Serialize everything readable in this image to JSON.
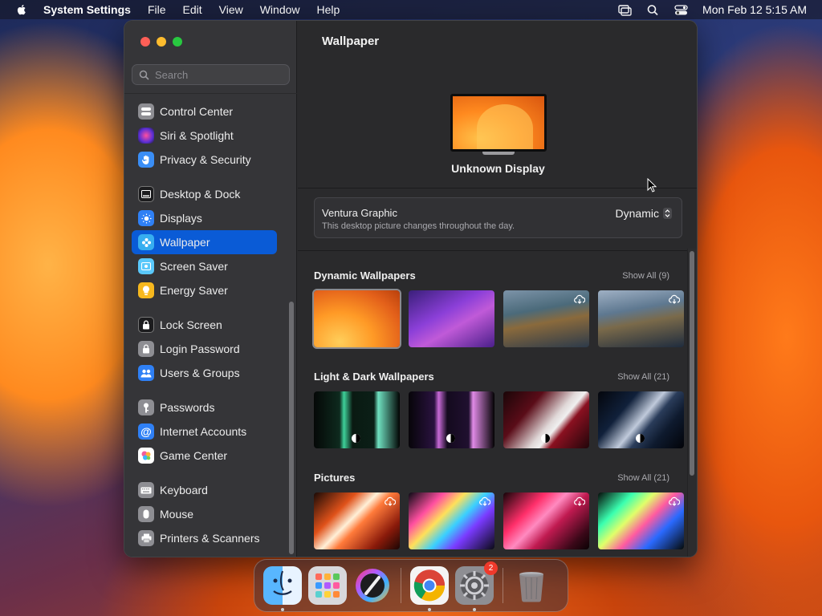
{
  "menubar": {
    "app_name": "System Settings",
    "menus": [
      "File",
      "Edit",
      "View",
      "Window",
      "Help"
    ],
    "clock": "Mon Feb 12  5:15 AM"
  },
  "sidebar": {
    "search_placeholder": "Search",
    "items": [
      {
        "label": "Control Center",
        "icon": "control-center-icon",
        "color": "#8e8e93"
      },
      {
        "label": "Siri & Spotlight",
        "icon": "siri-icon",
        "color": "#b04ad0"
      },
      {
        "label": "Privacy & Security",
        "icon": "hand-icon",
        "color": "#3a8ef6"
      },
      {
        "label": "Desktop & Dock",
        "icon": "dock-icon",
        "color": "#1c1c1e"
      },
      {
        "label": "Displays",
        "icon": "sun-icon",
        "color": "#2f80f5"
      },
      {
        "label": "Wallpaper",
        "icon": "wallpaper-icon",
        "color": "#37aef0"
      },
      {
        "label": "Screen Saver",
        "icon": "screen-saver-icon",
        "color": "#5ac8fa"
      },
      {
        "label": "Energy Saver",
        "icon": "bulb-icon",
        "color": "#f6b81e"
      },
      {
        "label": "Lock Screen",
        "icon": "lock-icon",
        "color": "#1c1c1e"
      },
      {
        "label": "Login Password",
        "icon": "lock-icon",
        "color": "#8e8e93"
      },
      {
        "label": "Users & Groups",
        "icon": "users-icon",
        "color": "#2f80f5"
      },
      {
        "label": "Passwords",
        "icon": "key-icon",
        "color": "#8e8e93"
      },
      {
        "label": "Internet Accounts",
        "icon": "at-icon",
        "color": "#2f80f5"
      },
      {
        "label": "Game Center",
        "icon": "game-center-icon",
        "color": "#ffffff"
      },
      {
        "label": "Keyboard",
        "icon": "keyboard-icon",
        "color": "#8e8e93"
      },
      {
        "label": "Mouse",
        "icon": "mouse-icon",
        "color": "#8e8e93"
      },
      {
        "label": "Printers & Scanners",
        "icon": "printer-icon",
        "color": "#8e8e93"
      }
    ],
    "active": "Wallpaper"
  },
  "content": {
    "title": "Wallpaper",
    "display_name": "Unknown Display",
    "current": {
      "name": "Ventura Graphic",
      "description": "This desktop picture changes throughout the day.",
      "mode": "Dynamic"
    },
    "sections": [
      {
        "title": "Dynamic Wallpapers",
        "show_all": "Show All (9)"
      },
      {
        "title": "Light & Dark Wallpapers",
        "show_all": "Show All (21)"
      },
      {
        "title": "Pictures",
        "show_all": "Show All (21)"
      }
    ]
  },
  "dock": {
    "apps": [
      "Finder",
      "Launchpad",
      "Color Picker",
      "Google Chrome",
      "System Settings",
      "Trash"
    ],
    "settings_badge": "2"
  },
  "colors": {
    "accent": "#0a5bd6",
    "window_bg": "#2a2a2c",
    "sidebar_bg": "#353538"
  }
}
